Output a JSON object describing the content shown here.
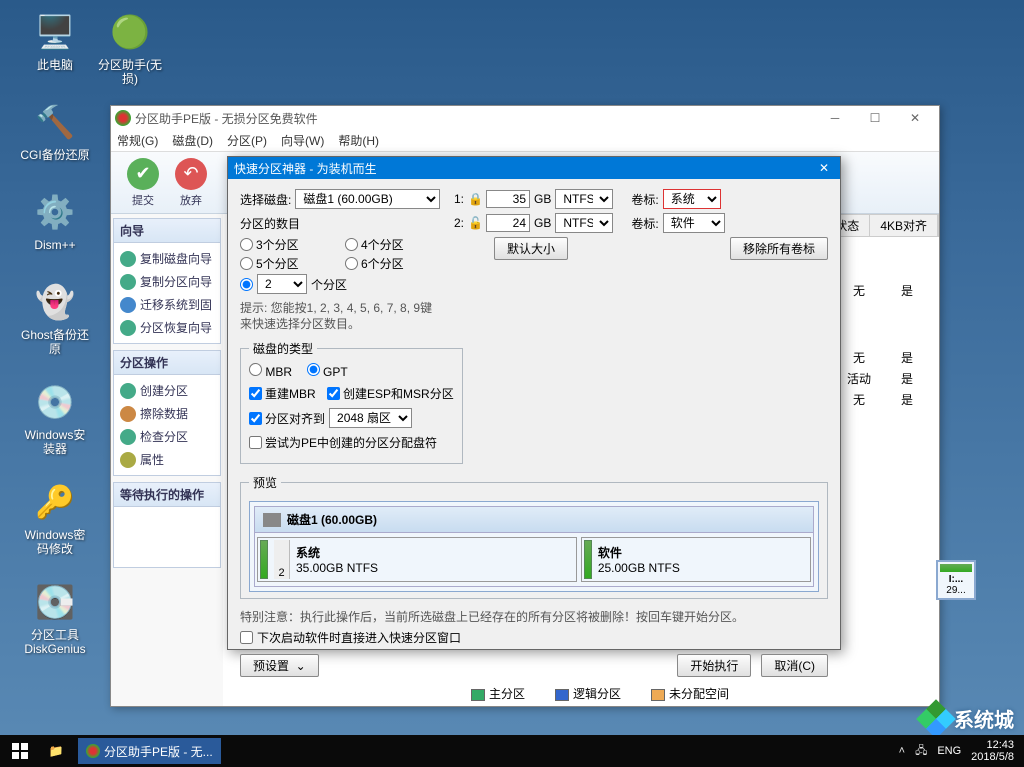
{
  "desktop_icons": [
    {
      "label": "此电脑"
    },
    {
      "label": "分区助手(无损)"
    },
    {
      "label": "CGI备份还原"
    },
    {
      "label": "Dism++"
    },
    {
      "label": "Ghost备份还原"
    },
    {
      "label": "Windows安装器"
    },
    {
      "label": "Windows密码修改"
    },
    {
      "label": "分区工具DiskGenius"
    }
  ],
  "mainwin": {
    "title": "分区助手PE版 - 无损分区免费软件",
    "menu": [
      "常规(G)",
      "磁盘(D)",
      "分区(P)",
      "向导(W)",
      "帮助(H)"
    ],
    "toolbar": [
      {
        "label": "提交"
      },
      {
        "label": "放弃"
      }
    ],
    "panel_wizard_title": "向导",
    "panel_wizard_items": [
      "复制磁盘向导",
      "复制分区向导",
      "迁移系统到固",
      "分区恢复向导"
    ],
    "panel_ops_title": "分区操作",
    "panel_ops_items": [
      "创建分区",
      "擦除数据",
      "检查分区",
      "属性"
    ],
    "panel_pending_title": "等待执行的操作",
    "grid_headers": [
      "状态",
      "4KB对齐"
    ],
    "grid_rows": [
      [
        "无",
        "是"
      ],
      [
        "无",
        "是"
      ],
      [
        "活动",
        "是"
      ],
      [
        "无",
        "是"
      ]
    ],
    "legend": {
      "primary": "主分区",
      "logical": "逻辑分区",
      "unalloc": "未分配空间"
    }
  },
  "dialog": {
    "title": "快速分区神器 - 为装机而生",
    "select_disk_label": "选择磁盘:",
    "select_disk_value": "磁盘1 (60.00GB)",
    "count_label": "分区的数目",
    "count_opts": [
      "3个分区",
      "4个分区",
      "5个分区",
      "6个分区"
    ],
    "count_custom_suffix": "个分区",
    "count_custom_val": "2",
    "hint": "提示: 您能按1, 2, 3, 4, 5, 6, 7, 8, 9键来快速选择分区数目。",
    "type_label": "磁盘的类型",
    "type_opts": [
      "MBR",
      "GPT"
    ],
    "rebuild_mbr": "重建MBR",
    "create_esp": "创建ESP和MSR分区",
    "align_label": "分区对齐到",
    "align_val": "2048 扇区",
    "try_pe": "尝试为PE中创建的分区分配盘符",
    "rows": [
      {
        "n": "1:",
        "locked": true,
        "size": "35",
        "unit": "GB",
        "fs": "NTFS",
        "vl": "卷标:",
        "vol": "系统"
      },
      {
        "n": "2:",
        "locked": false,
        "size": "24",
        "unit": "GB",
        "fs": "NTFS",
        "vl": "卷标:",
        "vol": "软件"
      }
    ],
    "default_size_btn": "默认大小",
    "remove_labels_btn": "移除所有卷标",
    "preview_label": "预览",
    "preview_disk": "磁盘1  (60.00GB)",
    "preview_parts": [
      {
        "num": "2",
        "name": "系统",
        "info": "35.00GB NTFS"
      },
      {
        "num": "",
        "name": "软件",
        "info": "25.00GB NTFS"
      }
    ],
    "warning": "特别注意：执行此操作后，当前所选磁盘上已经存在的所有分区将被删除！按回车键开始分区。",
    "next_time_chk": "下次启动软件时直接进入快速分区窗口",
    "preset_btn": "预设置",
    "start_btn": "开始执行",
    "cancel_btn": "取消(C)"
  },
  "rthumb": {
    "label": "I:...",
    "size": "29..."
  },
  "taskbar": {
    "app": "分区助手PE版 - 无...",
    "lang": "ENG",
    "time": "12:43",
    "date": "2018/5/8"
  },
  "watermark": "系统城"
}
